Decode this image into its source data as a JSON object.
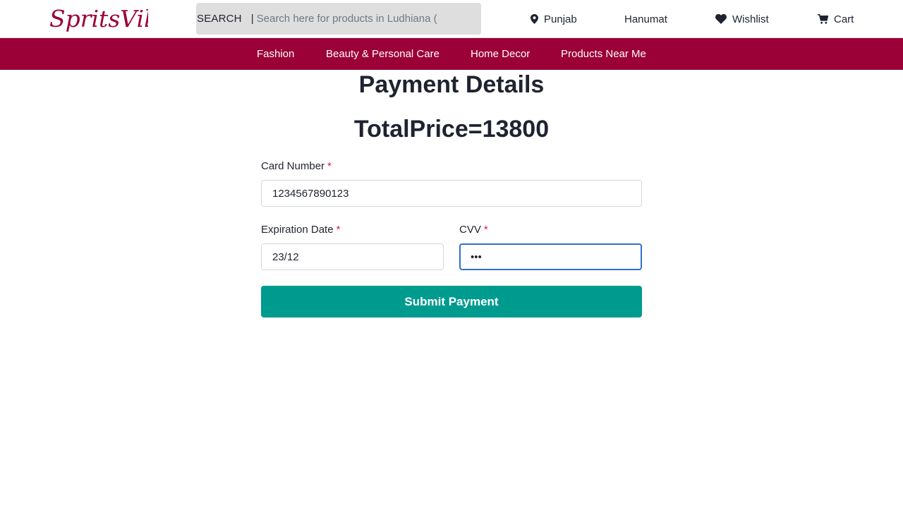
{
  "brand": {
    "logo_text": "SpritsVilla",
    "accent": "#9b0036"
  },
  "header": {
    "search_label": "SEARCH",
    "search_separator": "|",
    "search_placeholder": "Search here for products in Ludhiana (",
    "location": {
      "icon": "map-pin-icon",
      "label": "Punjab"
    },
    "user_label": "Hanumat",
    "wishlist": {
      "icon": "heart-icon",
      "label": "Wishlist"
    },
    "cart": {
      "icon": "cart-icon",
      "label": "Cart"
    }
  },
  "categories": [
    {
      "label": "Fashion"
    },
    {
      "label": "Beauty & Personal Care"
    },
    {
      "label": "Home Decor"
    },
    {
      "label": "Products Near Me"
    }
  ],
  "payment": {
    "title": "Payment Details",
    "total_text": "TotalPrice=13800",
    "card_number": {
      "label": "Card Number",
      "required_mark": "*",
      "value": "1234567890123"
    },
    "expiration": {
      "label": "Expiration Date",
      "required_mark": "*",
      "value": "23/12"
    },
    "cvv": {
      "label": "CVV",
      "required_mark": "*",
      "value": "123"
    },
    "submit_label": "Submit Payment",
    "submit_color": "#009b8f",
    "focus_color": "#2f70c9"
  }
}
